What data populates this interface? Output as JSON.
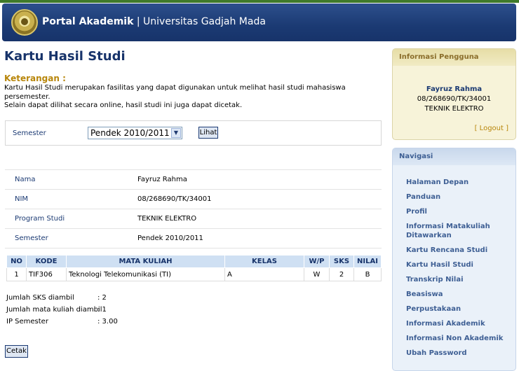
{
  "header": {
    "brand": "Portal Akademik",
    "separator": " | ",
    "university": "Universitas Gadjah Mada"
  },
  "page_title": "Kartu Hasil Studi",
  "keterangan": {
    "label": "Keterangan :",
    "line1": "Kartu Hasil Studi merupakan fasilitas yang dapat digunakan untuk melihat hasil studi mahasiswa persemester.",
    "line2": "Selain dapat dilihat secara online, hasil studi ini juga dapat dicetak."
  },
  "semester_filter": {
    "label": "Semester",
    "selected": "Pendek 2010/2011",
    "button": "Lihat"
  },
  "student": {
    "rows": [
      {
        "key": "Nama",
        "value": "Fayruz Rahma"
      },
      {
        "key": "NIM",
        "value": "08/268690/TK/34001"
      },
      {
        "key": "Program Studi",
        "value": "TEKNIK ELEKTRO"
      },
      {
        "key": "Semester",
        "value": "Pendek 2010/2011"
      }
    ]
  },
  "khs": {
    "headers": [
      "NO",
      "KODE",
      "MATA KULIAH",
      "KELAS",
      "W/P",
      "SKS",
      "NILAI"
    ],
    "rows": [
      [
        "1",
        "TIF306",
        "Teknologi Telekomunikasi (TI)",
        "A",
        "W",
        "2",
        "B"
      ]
    ]
  },
  "summary": [
    {
      "label": "Jumlah SKS diambil",
      "value": ": 2"
    },
    {
      "label": "Jumlah mata kuliah diambil",
      "value": ": 1"
    },
    {
      "label": "IP Semester",
      "value": ": 3.00"
    }
  ],
  "print_button": "Cetak",
  "user_panel": {
    "title": "Informasi Pengguna",
    "name": "Fayruz Rahma",
    "nim": "08/268690/TK/34001",
    "prodi": "TEKNIK ELEKTRO",
    "logout": "[ Logout ]"
  },
  "nav_panel": {
    "title": "Navigasi",
    "items": [
      "Halaman Depan",
      "Panduan",
      "Profil",
      "Informasi Matakuliah Ditawarkan",
      "Kartu Rencana Studi",
      "Kartu Hasil Studi",
      "Transkrip Nilai",
      "Beasiswa",
      "Perpustakaan",
      "Informasi Akademik",
      "Informasi Non Akademik",
      "Ubah Password"
    ]
  }
}
